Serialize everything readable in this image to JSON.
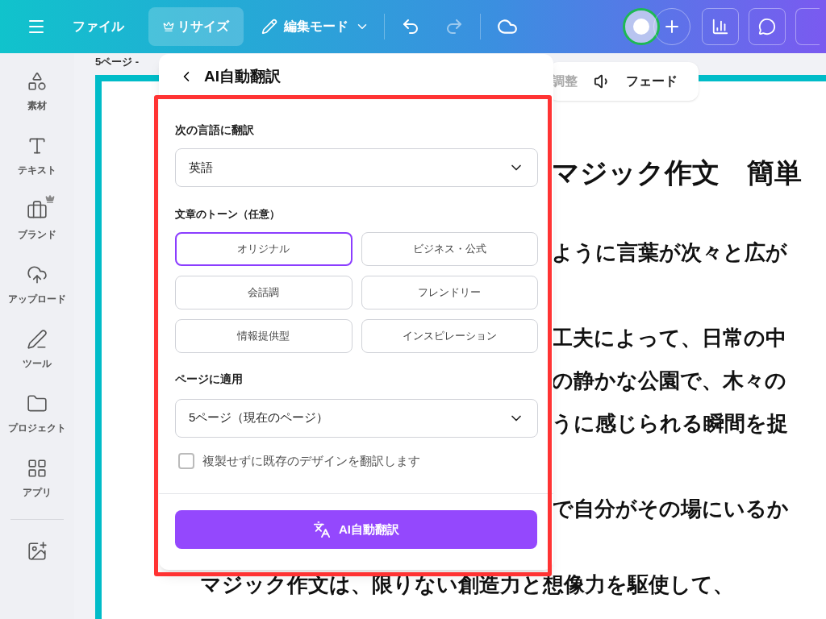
{
  "top_bar": {
    "file": "ファイル",
    "resize": "リサイズ",
    "edit_mode": "編集モード"
  },
  "document_title": "5ページ -",
  "sidebar": {
    "items": [
      {
        "label": "素材",
        "kind": "elements",
        "premium": false
      },
      {
        "label": "テキスト",
        "kind": "text",
        "premium": false
      },
      {
        "label": "ブランド",
        "kind": "brand",
        "premium": true
      },
      {
        "label": "アップロード",
        "kind": "upload",
        "premium": false
      },
      {
        "label": "ツール",
        "kind": "tools",
        "premium": false
      },
      {
        "label": "プロジェクト",
        "kind": "projects",
        "premium": false
      },
      {
        "label": "アプリ",
        "kind": "apps",
        "premium": false
      },
      {
        "kind": "magic",
        "premium": false
      }
    ]
  },
  "floating_toolbar": {
    "adjust": "調整",
    "fade": "フェード"
  },
  "page": {
    "heading": "マジック作文　簡単",
    "paragraphs": [
      [
        "ように言葉が次々と広が"
      ],
      [
        "工夫によって、日常の中",
        "の静かな公園で、木々の",
        "うに感じられる瞬間を捉"
      ],
      [
        "で自分がその場にいるか"
      ]
    ],
    "last_line": "マジック作文は、限りない創造力と想像力を駆使して、"
  },
  "panel": {
    "title": "AI自動翻訳",
    "language_label": "次の言語に翻訳",
    "language": "英語",
    "tone_label": "文章のトーン（任意）",
    "tones": [
      {
        "label": "オリジナル",
        "selected": true
      },
      {
        "label": "ビジネス・公式",
        "selected": false
      },
      {
        "label": "会話調",
        "selected": false
      },
      {
        "label": "フレンドリー",
        "selected": false
      },
      {
        "label": "情報提供型",
        "selected": false
      },
      {
        "label": "インスピレーション",
        "selected": false
      }
    ],
    "apply_label": "ページに適用",
    "page": "5ページ（現在のページ）",
    "overwrite": {
      "label": "複製せずに既存のデザインを翻訳します",
      "checked": false
    },
    "submit": "AI自動翻訳"
  }
}
